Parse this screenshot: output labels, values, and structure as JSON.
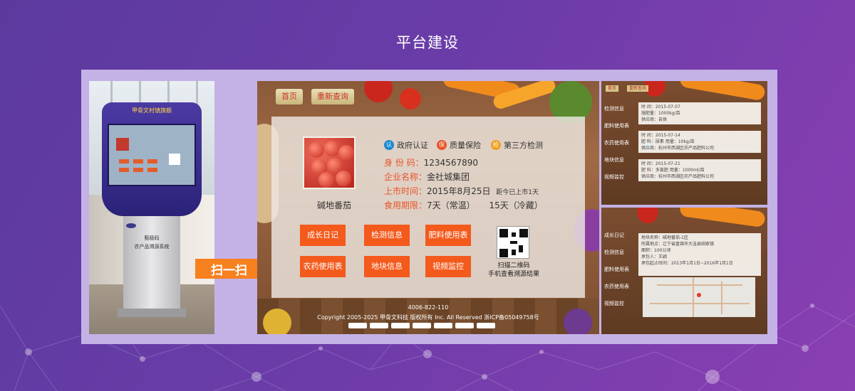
{
  "page": {
    "title": "平台建设"
  },
  "kiosk": {
    "brand_top": "甲骨文村镇旗舰",
    "brand_name": "甄极码",
    "brand_sub": "农产品溯源系统"
  },
  "scan": {
    "label": "扫一扫"
  },
  "app": {
    "nav": {
      "home": "首页",
      "requery": "重新查询"
    },
    "badges": [
      {
        "mark": "认",
        "label": "政府认证",
        "color": "#1f8ad0"
      },
      {
        "mark": "保",
        "label": "质量保险",
        "color": "#e8542a"
      },
      {
        "mark": "检",
        "label": "第三方检测",
        "color": "#f0a020"
      }
    ],
    "product": {
      "name": "碱地番茄",
      "id_label": "身 份 码：",
      "id_value": "1234567890",
      "company_label": "企业名称：",
      "company_value": "金社城集团",
      "date_label": "上市时间：",
      "date_value": "2015年8月25日",
      "date_note": "距今已上市1天",
      "shelf_label": "食用期限：",
      "shelf_normal": "7天（常温）",
      "shelf_cold": "15天（冷藏）"
    },
    "buttons": [
      "成长日记",
      "检测信息",
      "肥料使用表",
      "农药使用表",
      "地块信息",
      "视频监控"
    ],
    "qr": {
      "line1": "扫描二维码",
      "line2": "手机查看溯源结果"
    },
    "footer": {
      "phone": "4006-822-110",
      "copyright": "Copyright 2005-2025 甲骨文科技 版权所有 Inc. All Reserved 浙ICP备05049758号"
    }
  },
  "side1": {
    "nav": {
      "home": "首页",
      "requery": "重新查询"
    },
    "menu": [
      "检测信息",
      "肥料使用表",
      "农药使用表",
      "地块信息",
      "视频监控"
    ],
    "rows": [
      {
        "time": "时 间：2015-07-07",
        "detail": "施肥量：1000kg/亩",
        "place": "供应商：自供"
      },
      {
        "time": "时 间：2015-07-14",
        "detail": "肥 料：尿素 用量：10kg/亩",
        "place": "供应商：杭州市西湖区农产品肥料公司"
      },
      {
        "time": "时 间：2015-07-21",
        "detail": "肥 料：多氯肥 用量：1000ml/亩",
        "place": "供应商：杭州市西湖区农产品肥料公司"
      }
    ]
  },
  "side2": {
    "menu": [
      "成长日记",
      "检测信息",
      "肥料使用表",
      "农药使用表",
      "视频监控"
    ],
    "info": [
      "地块名称：碱地番茄-1区",
      "所属地点：辽宁省盘锦市大洼县田家镇",
      "面积：100公顷",
      "承包人：王颖",
      "承包起止时间：2013年1月1日~2016年1月1日"
    ]
  }
}
